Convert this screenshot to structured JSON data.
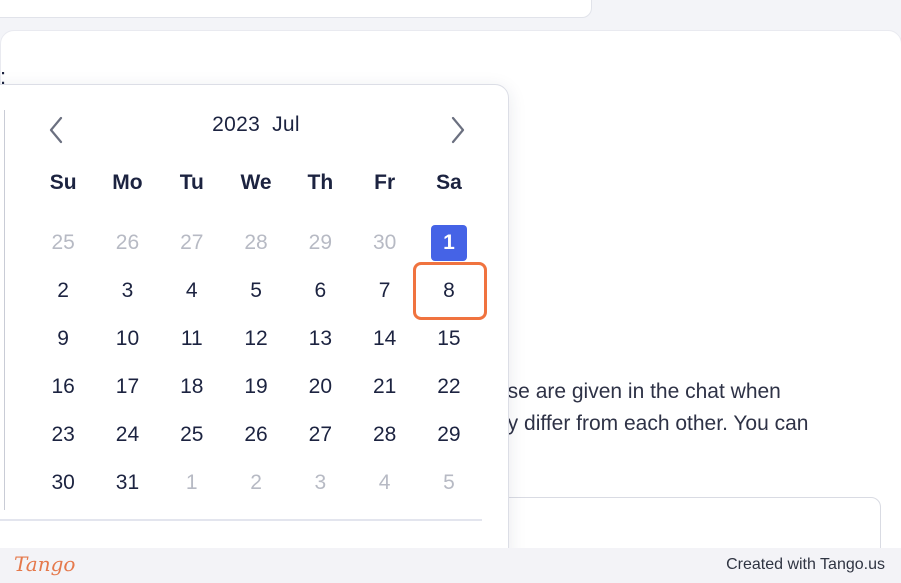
{
  "form": {
    "label_fragment": ":",
    "help_line_1": "ese are given in the chat when",
    "help_line_2": "ey differ from each other. You can"
  },
  "calendar": {
    "year": "2023",
    "month": "Jul",
    "prev_icon": "chevron-left-icon",
    "next_icon": "chevron-right-icon",
    "weekdays": [
      "Su",
      "Mo",
      "Tu",
      "We",
      "Th",
      "Fr",
      "Sa"
    ],
    "weeks": [
      [
        {
          "day": "25",
          "muted": true
        },
        {
          "day": "26",
          "muted": true
        },
        {
          "day": "27",
          "muted": true
        },
        {
          "day": "28",
          "muted": true
        },
        {
          "day": "29",
          "muted": true
        },
        {
          "day": "30",
          "muted": true
        },
        {
          "day": "1",
          "selected": true
        }
      ],
      [
        {
          "day": "2"
        },
        {
          "day": "3"
        },
        {
          "day": "4"
        },
        {
          "day": "5"
        },
        {
          "day": "6"
        },
        {
          "day": "7"
        },
        {
          "day": "8",
          "highlighted": true
        }
      ],
      [
        {
          "day": "9"
        },
        {
          "day": "10"
        },
        {
          "day": "11"
        },
        {
          "day": "12"
        },
        {
          "day": "13"
        },
        {
          "day": "14"
        },
        {
          "day": "15"
        }
      ],
      [
        {
          "day": "16"
        },
        {
          "day": "17"
        },
        {
          "day": "18"
        },
        {
          "day": "19"
        },
        {
          "day": "20"
        },
        {
          "day": "21"
        },
        {
          "day": "22"
        }
      ],
      [
        {
          "day": "23"
        },
        {
          "day": "24"
        },
        {
          "day": "25"
        },
        {
          "day": "26"
        },
        {
          "day": "27"
        },
        {
          "day": "28"
        },
        {
          "day": "29"
        }
      ],
      [
        {
          "day": "30"
        },
        {
          "day": "31"
        },
        {
          "day": "1",
          "muted": true
        },
        {
          "day": "2",
          "muted": true
        },
        {
          "day": "3",
          "muted": true
        },
        {
          "day": "4",
          "muted": true
        },
        {
          "day": "5",
          "muted": true
        }
      ]
    ],
    "colors": {
      "selected": "#4563e6",
      "highlight": "#f0733f",
      "text": "#1c2340",
      "muted": "#b7bac4"
    }
  },
  "footer": {
    "logo": "Tango",
    "credit": "Created with Tango.us"
  }
}
